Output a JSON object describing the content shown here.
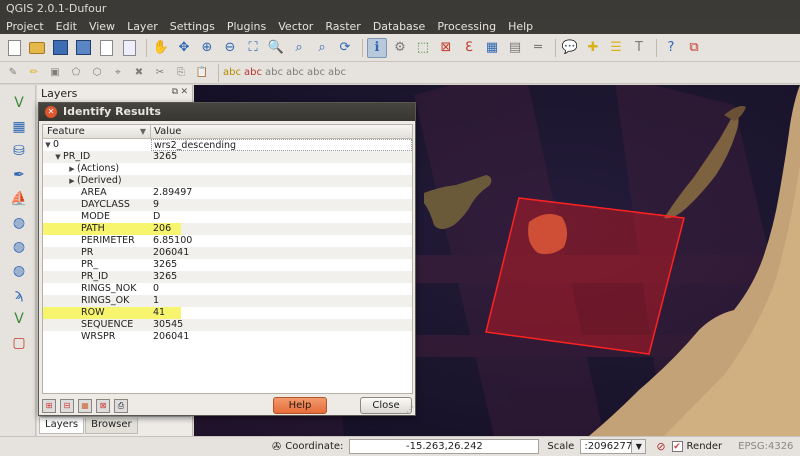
{
  "window": {
    "title": "QGIS 2.0.1-Dufour"
  },
  "menu": [
    {
      "label": "Project"
    },
    {
      "label": "Edit"
    },
    {
      "label": "View"
    },
    {
      "label": "Layer"
    },
    {
      "label": "Settings"
    },
    {
      "label": "Plugins"
    },
    {
      "label": "Vector"
    },
    {
      "label": "Raster"
    },
    {
      "label": "Database"
    },
    {
      "label": "Processing"
    },
    {
      "label": "Help"
    }
  ],
  "layers_panel": {
    "title": "Layers",
    "tabs": [
      {
        "label": "Layers"
      },
      {
        "label": "Browser"
      }
    ]
  },
  "identify": {
    "title": "Identify Results",
    "columns": [
      "Feature",
      "Value"
    ],
    "rows": [
      {
        "key": "0",
        "value": "wrs2_descending"
      },
      {
        "key": "PR_ID",
        "value": "3265"
      },
      {
        "key": "(Actions)",
        "value": ""
      },
      {
        "key": "(Derived)",
        "value": ""
      },
      {
        "key": "AREA",
        "value": "2.89497"
      },
      {
        "key": "DAYCLASS",
        "value": "9"
      },
      {
        "key": "MODE",
        "value": "D"
      },
      {
        "key": "PATH",
        "value": "206"
      },
      {
        "key": "PERIMETER",
        "value": "6.85100"
      },
      {
        "key": "PR",
        "value": "206041"
      },
      {
        "key": "PR_",
        "value": "3265"
      },
      {
        "key": "PR_ID",
        "value": "3265"
      },
      {
        "key": "RINGS_NOK",
        "value": "0"
      },
      {
        "key": "RINGS_OK",
        "value": "1"
      },
      {
        "key": "ROW",
        "value": "41"
      },
      {
        "key": "SEQUENCE",
        "value": "30545"
      },
      {
        "key": "WRSPR",
        "value": "206041"
      }
    ],
    "help_label": "Help",
    "close_label": "Close"
  },
  "status": {
    "coordinate_label": "Coordinate:",
    "coordinate_value": "-15.263,26.242",
    "scale_label": "Scale",
    "scale_value": ":2096277",
    "render_label": "Render",
    "crs": "EPSG:4326"
  },
  "colors": {
    "highlight": "#f7f46d",
    "selection": "#ff1a1a",
    "help_button": "#e56c3a"
  }
}
